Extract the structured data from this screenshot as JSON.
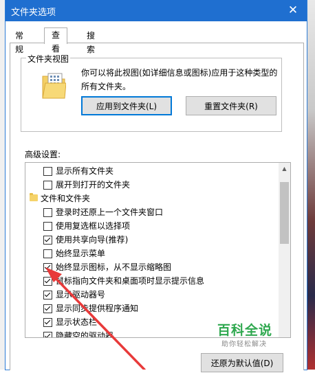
{
  "window": {
    "title": "文件夹选项",
    "close_glyph": "✕"
  },
  "tabs": [
    {
      "label": "常规"
    },
    {
      "label": "查看"
    },
    {
      "label": "搜索"
    }
  ],
  "folder_views": {
    "group_label": "文件夹视图",
    "description": "你可以将此视图(如详细信息或图标)应用于这种类型的所有文件夹。",
    "apply_button": "应用到文件夹(L)",
    "reset_button": "重置文件夹(R)"
  },
  "advanced": {
    "label": "高级设置:",
    "items": [
      {
        "type": "check",
        "label": "显示所有文件夹",
        "checked": false
      },
      {
        "type": "check",
        "label": "展开到打开的文件夹",
        "checked": false
      },
      {
        "type": "category",
        "label": "文件和文件夹"
      },
      {
        "type": "check",
        "label": "登录时还原上一个文件夹窗口",
        "checked": false
      },
      {
        "type": "check",
        "label": "使用复选框以选择项",
        "checked": false
      },
      {
        "type": "check",
        "label": "使用共享向导(推荐)",
        "checked": true
      },
      {
        "type": "check",
        "label": "始终显示菜单",
        "checked": false
      },
      {
        "type": "check",
        "label": "始终显示图标，从不显示缩略图",
        "checked": true
      },
      {
        "type": "check",
        "label": "鼠标指向文件夹和桌面项时显示提示信息",
        "checked": true
      },
      {
        "type": "check",
        "label": "显示驱动器号",
        "checked": true
      },
      {
        "type": "check",
        "label": "显示同步提供程序通知",
        "checked": true
      },
      {
        "type": "check",
        "label": "显示状态栏",
        "checked": true
      },
      {
        "type": "check",
        "label": "隐藏空的驱动器",
        "checked": true
      }
    ],
    "restore_button": "还原为默认值(D)"
  },
  "watermark": {
    "main": "百科全说",
    "sub": "助你轻松解决"
  },
  "colors": {
    "titlebar": "#1f6fd0",
    "arrow": "#e83a3a",
    "watermark": "#2fa84f"
  }
}
